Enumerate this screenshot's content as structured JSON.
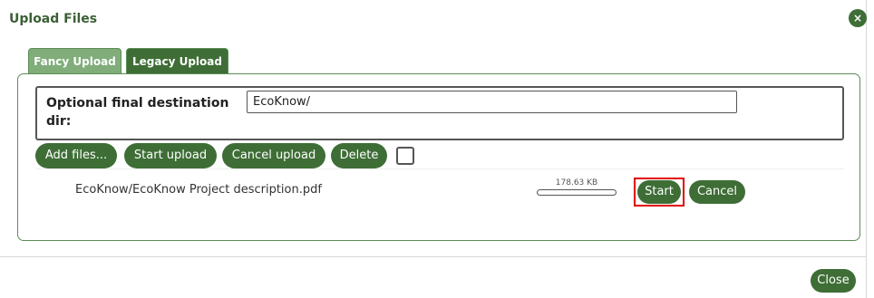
{
  "dialog": {
    "title": "Upload Files",
    "close_icon_glyph": "×",
    "close_button_label": "Close"
  },
  "tabs": [
    {
      "label": "Fancy Upload",
      "active": true
    },
    {
      "label": "Legacy Upload",
      "active": false
    }
  ],
  "destination": {
    "label": "Optional final destination dir:",
    "value": "EcoKnow/"
  },
  "toolbar": {
    "add_files_label": "Add files...",
    "start_upload_label": "Start upload",
    "cancel_upload_label": "Cancel upload",
    "delete_label": "Delete",
    "select_all_checked": false
  },
  "files": [
    {
      "name": "EcoKnow/EcoKnow Project description.pdf",
      "size": "178.63 KB",
      "progress": 0,
      "start_label": "Start",
      "cancel_label": "Cancel"
    }
  ],
  "colors": {
    "button_green": "#3e6e36",
    "active_tab": "#80ad7a",
    "title_green": "#3b5f35",
    "highlight_red": "#e00000"
  },
  "icons": {
    "close": "close-icon"
  }
}
